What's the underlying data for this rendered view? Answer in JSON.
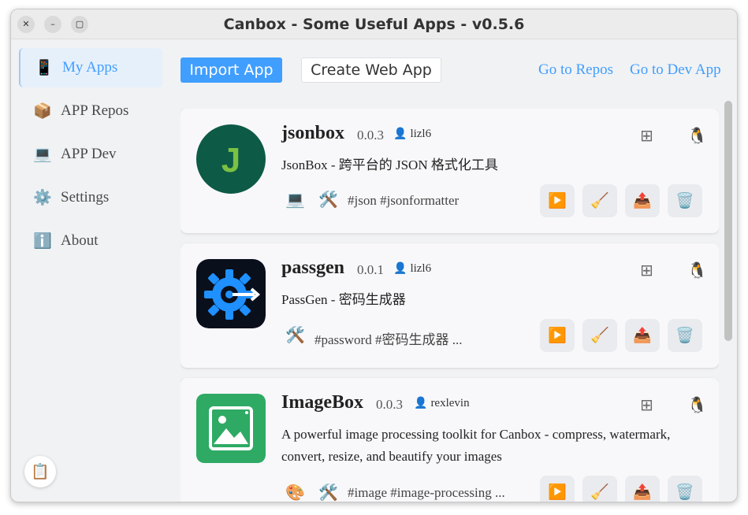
{
  "window": {
    "title": "Canbox - Some Useful Apps - v0.5.6",
    "close_glyph": "✕",
    "minimize_glyph": "–",
    "maximize_glyph": "▢"
  },
  "sidebar": {
    "items": [
      {
        "label": "My Apps",
        "icon": "📱",
        "icon_name": "phone-icon",
        "active": true
      },
      {
        "label": "APP Repos",
        "icon": "📦",
        "icon_name": "package-icon",
        "active": false
      },
      {
        "label": "APP Dev",
        "icon": "💻",
        "icon_name": "laptop-icon",
        "active": false
      },
      {
        "label": "Settings",
        "icon": "⚙️",
        "icon_name": "gear-icon",
        "active": false
      },
      {
        "label": "About",
        "icon": "ℹ️",
        "icon_name": "info-icon",
        "active": false
      }
    ],
    "clipboard_icon": "📋"
  },
  "toolbar": {
    "import_label": "Import App",
    "create_label": "Create Web App",
    "repos_link": "Go to Repos",
    "dev_link": "Go to Dev App"
  },
  "action_icons": {
    "run": "▶️",
    "clean": "🧹",
    "export": "📤",
    "delete": "🗑️"
  },
  "os_icons": {
    "windows": "⊞",
    "apple": "",
    "linux": "🐧"
  },
  "apps": [
    {
      "name": "jsonbox",
      "version": "0.0.3",
      "author": "lizl6",
      "description": "JsonBox - 跨平台的 JSON 格式化工具",
      "tag_icons": [
        "💻",
        "🛠️"
      ],
      "tags": "#json #jsonformatter",
      "icon_letter": "J"
    },
    {
      "name": "passgen",
      "version": "0.0.1",
      "author": "lizl6",
      "description": "PassGen - 密码生成器",
      "tag_icons": [
        "🛠️"
      ],
      "tags": "#password #密码生成器 ..."
    },
    {
      "name": "ImageBox",
      "version": "0.0.3",
      "author": "rexlevin",
      "description_line1": "A powerful image processing toolkit for Canbox - compress, watermark,",
      "description_line2": "convert, resize, and beautify your images",
      "tag_icons": [
        "🎨",
        "🛠️"
      ],
      "tags": "#image #image-processing ..."
    }
  ],
  "colors": {
    "accent": "#409eff",
    "jsonbox_icon_bg": "#0d5a47",
    "jsonbox_letter": "#7bc142",
    "passgen_icon_bg": "#0a0f1c",
    "passgen_gear": "#1e90ff",
    "imagebox_icon_bg": "#2eaa64"
  }
}
